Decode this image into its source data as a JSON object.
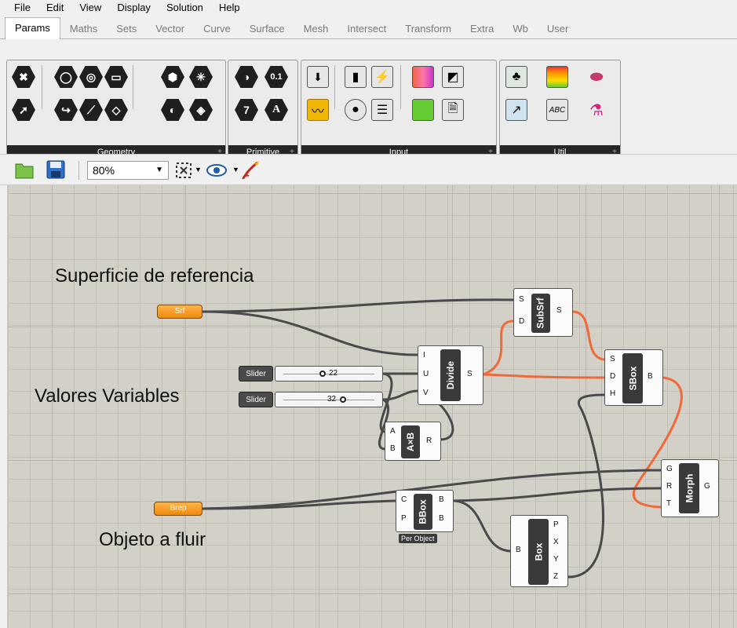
{
  "menu": [
    "File",
    "Edit",
    "View",
    "Display",
    "Solution",
    "Help"
  ],
  "tabs": [
    "Params",
    "Maths",
    "Sets",
    "Vector",
    "Curve",
    "Surface",
    "Mesh",
    "Intersect",
    "Transform",
    "Extra",
    "Wb",
    "User"
  ],
  "active_tab": "Params",
  "groups": {
    "geometry": "Geometry",
    "primitive": "Primitive",
    "input": "Input",
    "util": "Util"
  },
  "primitive_icons": {
    "number": "0.1",
    "integer": "7",
    "text": "A"
  },
  "toolbar": {
    "zoom": "80%"
  },
  "canvas_labels": {
    "surface": "Superficie de referencia",
    "variables": "Valores Variables",
    "object": "Objeto a fluir"
  },
  "components": {
    "srf": "Srf",
    "brep": "Brep",
    "subsrf": {
      "name": "SubSrf",
      "in": [
        "S",
        "D"
      ],
      "out": [
        "S"
      ]
    },
    "divide": {
      "name": "Divide",
      "in": [
        "I",
        "U",
        "V"
      ],
      "out": [
        "S"
      ]
    },
    "sbox": {
      "name": "SBox",
      "in": [
        "S",
        "D",
        "H"
      ],
      "out": [
        "B"
      ]
    },
    "axb": {
      "name": "A×B",
      "in": [
        "A",
        "B"
      ],
      "out": [
        "R"
      ]
    },
    "morph": {
      "name": "Morph",
      "in": [
        "G",
        "R",
        "T"
      ],
      "out": [
        "G"
      ]
    },
    "bbox": {
      "name": "BBox",
      "in": [
        "C",
        "P"
      ],
      "out": [
        "B",
        "B"
      ],
      "caption": "Per Object"
    },
    "box": {
      "name": "Box",
      "in": [
        "B"
      ],
      "out": [
        "P",
        "X",
        "Y",
        "Z"
      ]
    }
  },
  "sliders": [
    {
      "label": "Slider",
      "value": "22"
    },
    {
      "label": "Slider",
      "value": "32"
    }
  ]
}
